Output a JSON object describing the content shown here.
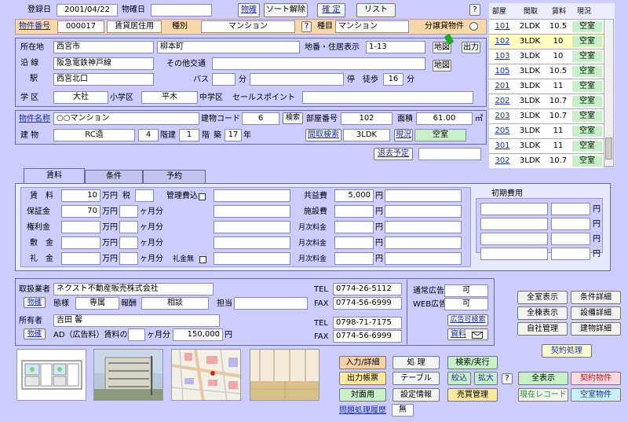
{
  "top": {
    "reg_label": "登録日",
    "reg_date": "2001/04/22",
    "confirm_label": "物確日",
    "confirm_date": "",
    "btn_bukken": "物確",
    "btn_sort": "ソート解除",
    "btn_kakutei": "確 定",
    "btn_list": "リスト",
    "help": "?"
  },
  "hdr": {
    "no_label": "物件番号",
    "no": "000017",
    "use": "賃貸居住用",
    "kind_label": "種別",
    "kind": "マンション",
    "q": "?",
    "item_label": "種目",
    "item": "マンション",
    "bunjo_label": "分譲貸物件"
  },
  "loc": {
    "label": "所在地",
    "city": "西宮市",
    "town": "柳本町",
    "chiban_label": "地番・住居表示",
    "chiban": "1-13",
    "map_btn": "地図",
    "out_btn": "出力",
    "line_label": "沿 線",
    "line": "阪急電鉄神戸線",
    "other_label": "その他交通",
    "sta_label": "駅",
    "sta": "西宮北口",
    "map_btn2": "地図",
    "bus_label": "バス",
    "min1": "分",
    "stop_label": "停",
    "walk_label": "徒歩",
    "walk": "16",
    "min2": "分"
  },
  "school": {
    "label": "学 区",
    "elem": "大社",
    "elem_label": "小学区",
    "mid": "平木",
    "mid_label": "中学区",
    "sales_label": "セールスポイント"
  },
  "bldg": {
    "name_label": "物件名称",
    "name": "○○マンション",
    "code_label": "建物コード",
    "code": "6",
    "search": "検索",
    "room_label": "部屋番号",
    "room": "102",
    "area_label": "面積",
    "area": "61.00",
    "area_unit": "㎡",
    "struct_label": "建 物",
    "struct": "RC造",
    "floor": "4",
    "floor_unit": "階建",
    "fl": "1",
    "fl_unit": "階",
    "age_label": "築",
    "age": "17",
    "age_unit": "年",
    "layout_btn": "間取検索",
    "layout": "3LDK",
    "status_btn": "現況",
    "status": "空室",
    "exit_btn": "退去予定"
  },
  "rooms": {
    "headers": [
      "部屋",
      "間取",
      "賃料",
      "現況"
    ],
    "rows": [
      {
        "room": "101",
        "layout": "2LDK",
        "rent": "10.5",
        "status": "空室"
      },
      {
        "room": "102",
        "layout": "3LDK",
        "rent": "10",
        "status": "空室"
      },
      {
        "room": "103",
        "layout": "3LDK",
        "rent": "10",
        "status": "空室"
      },
      {
        "room": "105",
        "layout": "3LDK",
        "rent": "10.5",
        "status": "空室"
      },
      {
        "room": "201",
        "layout": "3LDK",
        "rent": "11",
        "status": "空室"
      },
      {
        "room": "202",
        "layout": "3LDK",
        "rent": "10.7",
        "status": "空室"
      },
      {
        "room": "203",
        "layout": "3LDK",
        "rent": "10.7",
        "status": "空室"
      },
      {
        "room": "205",
        "layout": "3LDK",
        "rent": "11",
        "status": "空室"
      },
      {
        "room": "301",
        "layout": "3LDK",
        "rent": "11",
        "status": "空室"
      },
      {
        "room": "302",
        "layout": "3LDK",
        "rent": "10.7",
        "status": "空室"
      }
    ]
  },
  "tabs": [
    "賃料",
    "条件",
    "予約"
  ],
  "fee": {
    "rent_label": "賃　料",
    "rent": "10",
    "man_yen": "万円",
    "tax": "税",
    "mgmt_label": "管理費込",
    "deposit_label": "保証金",
    "deposit": "70",
    "month": "ヶ月分",
    "key_label": "権利金",
    "shiki_label": "敷　金",
    "rei_label": "礼　金",
    "rei_none": "礼金無",
    "common_label": "共益費",
    "common": "5,000",
    "yen": "円",
    "facility_label": "施設費",
    "monthly1": "月次料金",
    "monthly2": "月次料金",
    "monthly3": "月次料金",
    "initial_label": "初期費用",
    "y1": "円",
    "y2": "円",
    "y3": "円",
    "y4": "円"
  },
  "agent": {
    "label": "取扱業者",
    "name": "ネクスト不動産販売株式会社",
    "btn": "物確",
    "tel_label": "TEL",
    "tel": "0774-26-5112",
    "fax_label": "FAX",
    "fax": "0774-56-6999",
    "mode_label": "態様",
    "mode": "専属",
    "fee_label": "報酬",
    "fee": "相談",
    "staff_label": "担当",
    "ad_label": "通常広告",
    "ad": "可",
    "web_label": "WEB広告",
    "web": "可",
    "ad_search": "広告可検索",
    "doc": "資料"
  },
  "owner": {
    "label": "所有者",
    "name": "吉田 馨",
    "btn": "物確",
    "tel_label": "TEL",
    "tel": "0798-71-7175",
    "fax_label": "FAX",
    "fax": "0774-56-6999",
    "ad_label": "AD（広告料）賃料の",
    "months_unit": "ヶ月分",
    "ad_amount": "150,000",
    "yen": "円"
  },
  "right_btns": [
    "全室表示",
    "条件詳細",
    "全棟表示",
    "設備詳細",
    "自社管理",
    "建物詳細"
  ],
  "contract": "契約処理",
  "bottom": {
    "b1": "入力/詳細",
    "b2": "処 理",
    "b3": "検索/実行",
    "b4": "出力帳票",
    "b5": "テーブル",
    "b6": "絞込",
    "b7": "拡大",
    "q": "?",
    "b8": "全表示",
    "b9": "契約物件",
    "b10": "対面用",
    "b11": "設定情報",
    "b12": "売買管理",
    "b13": "現在レコード",
    "b14": "空室物件",
    "history": "問題処理履歴",
    "history_val": "無"
  },
  "colors": {
    "bg": "#ccccfe",
    "orange": "#f8d8a8",
    "green": "#c8f0c8",
    "link": "#1a2fa0"
  }
}
